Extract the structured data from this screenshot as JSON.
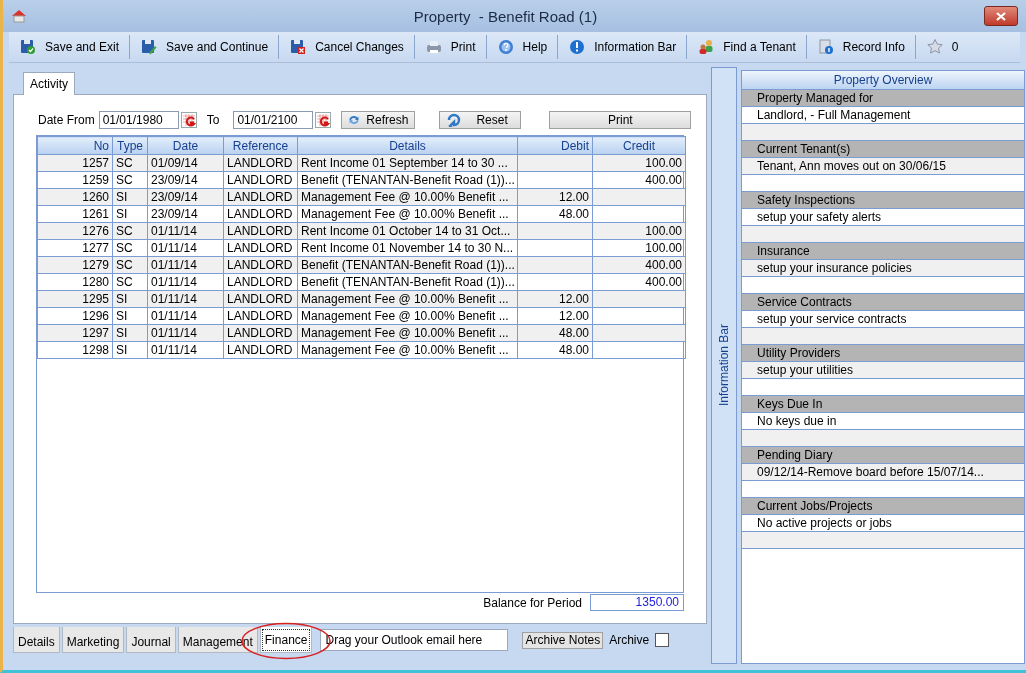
{
  "window": {
    "title": "Property  - Benefit Road (1)"
  },
  "toolbar": [
    {
      "label": "Save and Exit"
    },
    {
      "label": "Save and Continue"
    },
    {
      "label": "Cancel Changes"
    },
    {
      "label": "Print"
    },
    {
      "label": "Help"
    },
    {
      "label": "Information Bar"
    },
    {
      "label": "Find a Tenant"
    },
    {
      "label": "Record Info"
    },
    {
      "label": "0"
    }
  ],
  "top_tabs": [
    {
      "label": "Activity",
      "selected": true
    }
  ],
  "filter": {
    "from_label": "Date From",
    "from_value": "01/01/1980",
    "to_label": "To",
    "to_value": "01/01/2100",
    "refresh": "Refresh",
    "reset": "Reset",
    "print": "Print"
  },
  "table": {
    "columns": [
      "No",
      "Type",
      "Date",
      "Reference",
      "Details",
      "Debit",
      "Credit"
    ],
    "rows": [
      [
        "1257",
        "SC",
        "01/09/14",
        "LANDLORD",
        "Rent Income 01 September 14 to 30 ...",
        "",
        "100.00"
      ],
      [
        "1259",
        "SC",
        "23/09/14",
        "LANDLORD",
        "Benefit (TENANTAN-Benefit Road (1))...",
        "",
        "400.00"
      ],
      [
        "1260",
        "SI",
        "23/09/14",
        "LANDLORD",
        "Management Fee @ 10.00% Benefit ...",
        "12.00",
        ""
      ],
      [
        "1261",
        "SI",
        "23/09/14",
        "LANDLORD",
        "Management Fee @ 10.00% Benefit ...",
        "48.00",
        ""
      ],
      [
        "1276",
        "SC",
        "01/11/14",
        "LANDLORD",
        "Rent Income 01 October 14 to 31 Oct...",
        "",
        "100.00"
      ],
      [
        "1277",
        "SC",
        "01/11/14",
        "LANDLORD",
        "Rent Income 01 November 14 to 30 N...",
        "",
        "100.00"
      ],
      [
        "1279",
        "SC",
        "01/11/14",
        "LANDLORD",
        "Benefit (TENANTAN-Benefit Road (1))...",
        "",
        "400.00"
      ],
      [
        "1280",
        "SC",
        "01/11/14",
        "LANDLORD",
        "Benefit (TENANTAN-Benefit Road (1))...",
        "",
        "400.00"
      ],
      [
        "1295",
        "SI",
        "01/11/14",
        "LANDLORD",
        "Management Fee @ 10.00% Benefit ...",
        "12.00",
        ""
      ],
      [
        "1296",
        "SI",
        "01/11/14",
        "LANDLORD",
        "Management Fee @ 10.00% Benefit ...",
        "12.00",
        ""
      ],
      [
        "1297",
        "SI",
        "01/11/14",
        "LANDLORD",
        "Management Fee @ 10.00% Benefit ...",
        "48.00",
        ""
      ],
      [
        "1298",
        "SI",
        "01/11/14",
        "LANDLORD",
        "Management Fee @ 10.00% Benefit ...",
        "48.00",
        ""
      ]
    ]
  },
  "balance": {
    "label": "Balance for Period",
    "value": "1350.00"
  },
  "bottom_tabs": [
    {
      "label": "Details",
      "selected": false,
      "circled": false
    },
    {
      "label": "Marketing",
      "selected": false,
      "circled": false
    },
    {
      "label": "Journal",
      "selected": false,
      "circled": false
    },
    {
      "label": "Management",
      "selected": false,
      "circled": false
    },
    {
      "label": "Finance",
      "selected": true,
      "circled": true
    }
  ],
  "email_drop": {
    "placeholder": "Drag your Outlook email here"
  },
  "archive_notes": "Archive Notes",
  "archive": {
    "label": "Archive",
    "checked": false
  },
  "info_bar": {
    "label": "Information Bar"
  },
  "overview": {
    "title": "Property Overview",
    "sections": [
      {
        "heading": "Property Managed for",
        "value": "Landlord, - Full Management"
      },
      {
        "heading": "Current Tenant(s)",
        "value": "Tenant, Ann moves out on 30/06/15"
      },
      {
        "heading": "Safety Inspections",
        "value": "setup your safety alerts"
      },
      {
        "heading": "Insurance",
        "value": "setup your insurance policies"
      },
      {
        "heading": "Service Contracts",
        "value": "setup your service contracts"
      },
      {
        "heading": "Utility Providers",
        "value": "setup your utilities"
      },
      {
        "heading": "Keys Due In",
        "value": "No keys due in"
      },
      {
        "heading": "Pending Diary",
        "value": "09/12/14-Remove board before 15/07/14..."
      },
      {
        "heading": "Current Jobs/Projects",
        "value": "No active projects or jobs"
      }
    ]
  }
}
